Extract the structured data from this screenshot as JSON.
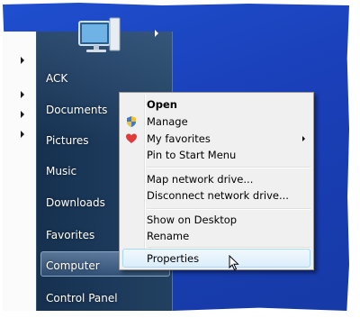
{
  "start_menu": {
    "items": [
      {
        "label": "ACK"
      },
      {
        "label": "Documents"
      },
      {
        "label": "Pictures"
      },
      {
        "label": "Music"
      },
      {
        "label": "Downloads"
      },
      {
        "label": "Favorites"
      },
      {
        "label": "Computer"
      },
      {
        "label": "Control Panel"
      }
    ]
  },
  "context_menu": {
    "items": [
      {
        "label": "Open"
      },
      {
        "label": "Manage"
      },
      {
        "label": "My favorites"
      },
      {
        "label": "Pin to Start Menu"
      },
      {
        "label": "Map network drive..."
      },
      {
        "label": "Disconnect network drive..."
      },
      {
        "label": "Show on Desktop"
      },
      {
        "label": "Rename"
      },
      {
        "label": "Properties"
      }
    ]
  },
  "icons": {
    "computer": "computer-monitor-icon",
    "manage": "shield-icon",
    "favorites": "heart-icon",
    "cursor": "mouse-pointer-icon"
  },
  "colors": {
    "desktop": "#1a3fb8",
    "start_menu_right": "#1d3a5c",
    "context_menu_bg": "#f0f0f0",
    "hover_border": "#a8d8f4"
  }
}
